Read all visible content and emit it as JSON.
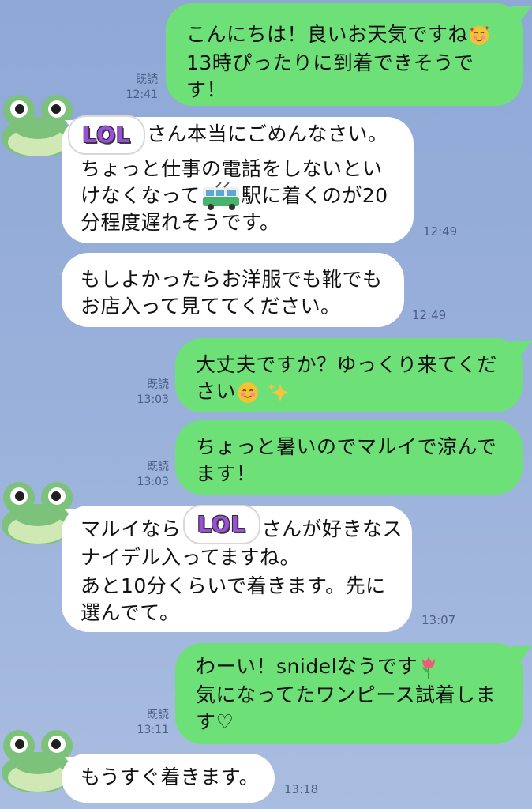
{
  "chat": {
    "messages": [
      {
        "sender": "me",
        "lines": [
          "こんにちは！良いお天気ですね",
          "13時ぴったりに到着できそうで",
          "す！"
        ],
        "read": "既読",
        "time": "12:41",
        "emoji": "smiling-hearts-emoji"
      },
      {
        "sender": "them",
        "lines": [
          "さん本当にごめんなさい。",
          "ちょっと仕事の電話をしないとい",
          "けなくなって",
          "駅に着くのが20",
          "分程度遅れそうです。"
        ],
        "time": "12:49",
        "sticker": "LOL",
        "emoji": "trolleybus-emoji"
      },
      {
        "sender": "them",
        "lines": [
          "もしよかったらお洋服でも靴でも",
          "お店入って見ててください。"
        ],
        "time": "12:49"
      },
      {
        "sender": "me",
        "lines": [
          "大丈夫ですか？ゆっくり来てくだ",
          "さい"
        ],
        "read": "既読",
        "time": "13:03",
        "emoji": "smiling-emoji",
        "emoji2": "sparkles-emoji"
      },
      {
        "sender": "me",
        "lines": [
          "ちょっと暑いのでマルイで涼んで",
          "ます！"
        ],
        "read": "既読",
        "time": "13:03"
      },
      {
        "sender": "them",
        "lines": [
          "マルイなら",
          "さんが好きなス",
          "ナイデル入ってますね。",
          "あと10分くらいで着きます。先に",
          "選んでて。"
        ],
        "time": "13:07",
        "sticker": "LOL"
      },
      {
        "sender": "me",
        "lines": [
          "わーい！snidelなうです",
          "気になってたワンピース試着しま",
          "す♡"
        ],
        "read": "既読",
        "time": "13:11",
        "emoji": "tulip-emoji"
      },
      {
        "sender": "them",
        "lines": [
          "もうすぐ着きます。"
        ],
        "time": "13:18"
      }
    ]
  }
}
